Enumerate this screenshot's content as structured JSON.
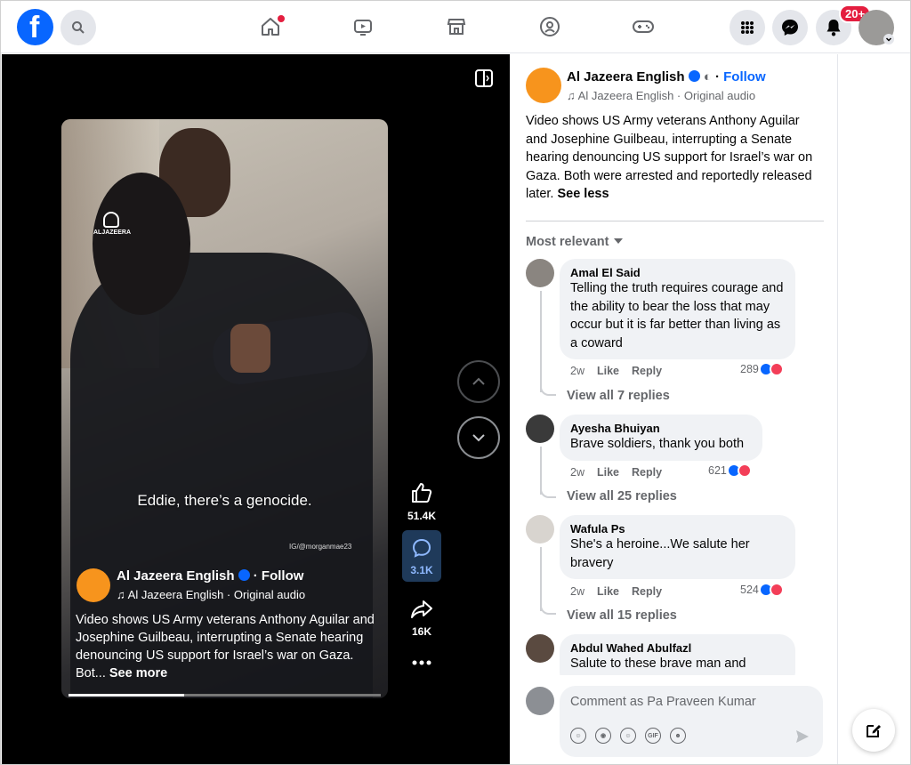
{
  "topnav": {
    "logo_letter": "f",
    "notifications_badge": "20+",
    "icons": [
      "search-icon",
      "home-icon",
      "video-icon",
      "marketplace-icon",
      "groups-icon",
      "gaming-icon",
      "menu-grid-icon",
      "messenger-icon",
      "bell-icon",
      "account-avatar"
    ]
  },
  "video": {
    "watermark": "ALJAZEERA",
    "caption": "Eddie, there’s a genocide.",
    "credit": "IG/@morganmae23",
    "page_name": "Al Jazeera English",
    "follow": "Follow",
    "audio": "Al Jazeera English · Original audio",
    "description": "Video shows US Army veterans Anthony Aguilar and Josephine Guilbeau, interrupting a Senate hearing denouncing US support for Israel’s war on Gaza. Bot...",
    "see_more": "See more",
    "progress": 0.37,
    "actions": {
      "likes": "51.4K",
      "comments": "3.1K",
      "shares": "16K"
    }
  },
  "panel": {
    "page_name": "Al Jazeera English",
    "follow": "Follow",
    "audio": "Al Jazeera English · Original audio",
    "description": "Video shows US Army veterans Anthony Aguilar and Josephine Guilbeau, interrupting a Senate hearing denouncing US support for Israel’s war on Gaza. Both were arrested and reportedly released later.",
    "see_less": "See less",
    "sort": "Most relevant"
  },
  "comments": [
    {
      "author": "Amal El Said",
      "text": "Telling the truth requires courage and the ability to bear the loss that may occur but it is far better than living as a coward",
      "time": "2w",
      "like": "Like",
      "reply": "Reply",
      "reactions": "289",
      "view_replies": "View all 7 replies"
    },
    {
      "author": "Ayesha Bhuiyan",
      "text": "Brave soldiers, thank you both",
      "time": "2w",
      "like": "Like",
      "reply": "Reply",
      "reactions": "621",
      "view_replies": "View all 25 replies"
    },
    {
      "author": "Wafula Ps",
      "text": "She's a heroine...We salute her bravery",
      "time": "2w",
      "like": "Like",
      "reply": "Reply",
      "reactions": "524",
      "view_replies": "View all 15 replies"
    },
    {
      "author": "Abdul Wahed Abulfazl",
      "text": "Salute to these brave man and"
    }
  ],
  "composer": {
    "placeholder": "Comment as Pa Praveen Kumar",
    "tool_gif": "GIF"
  },
  "colors": {
    "brand": "#0866ff",
    "badge": "#e41e3f",
    "aj_orange": "#f7941d"
  }
}
